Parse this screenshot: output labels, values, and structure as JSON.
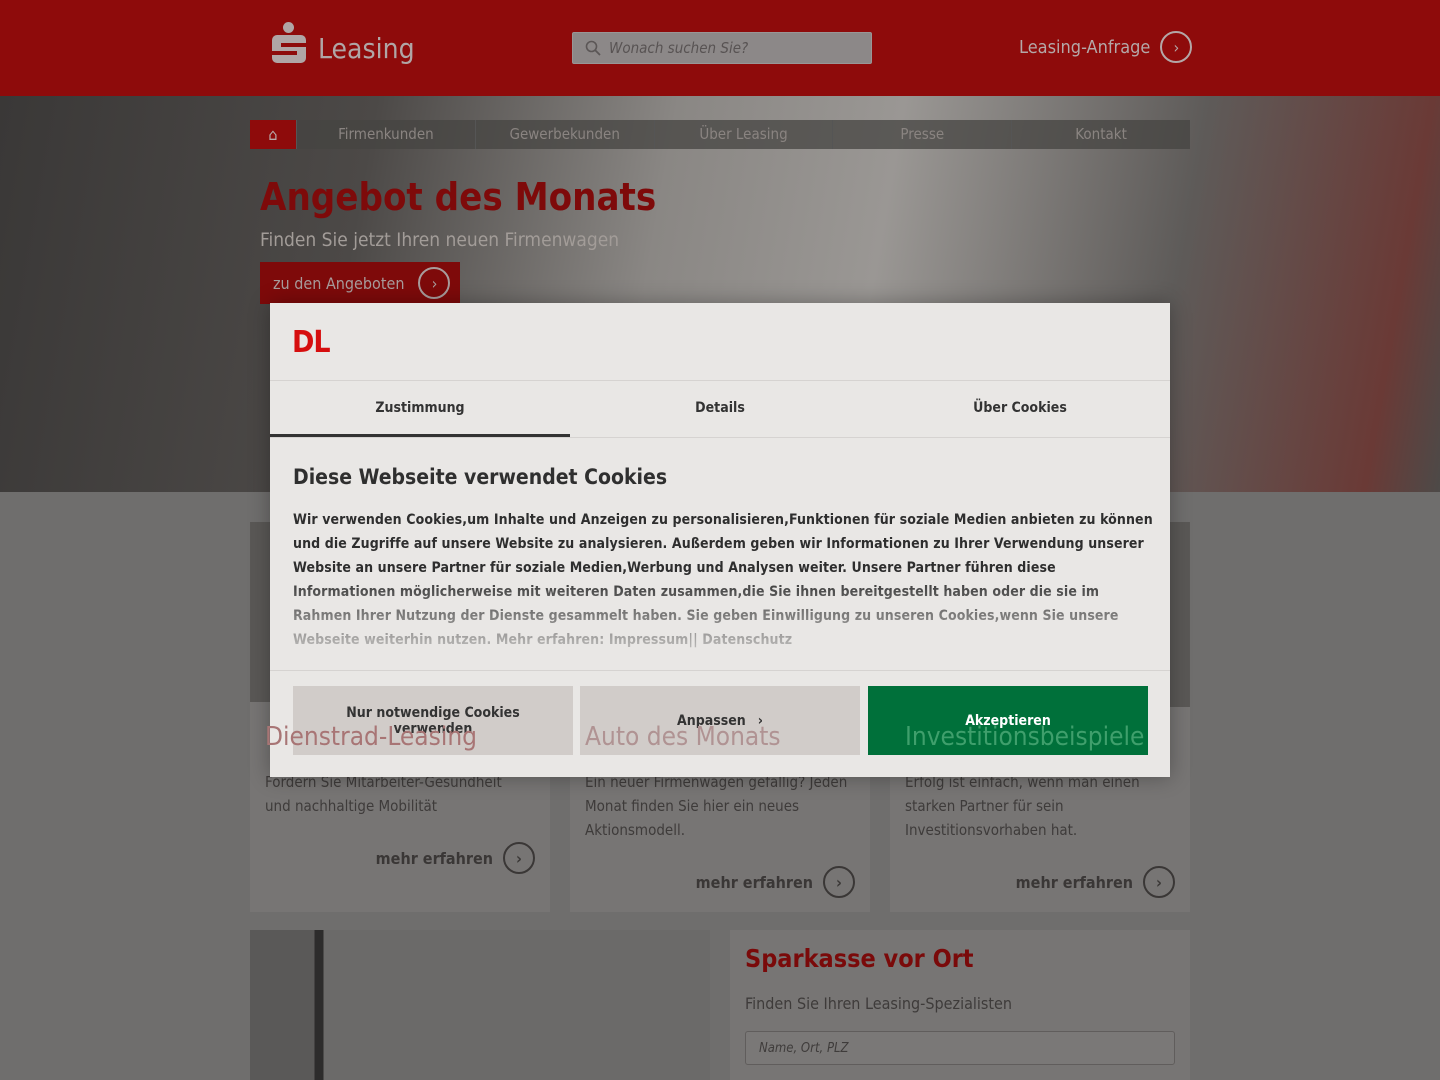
{
  "header": {
    "logo_text": "Leasing",
    "search_placeholder": "Wonach suchen Sie?",
    "cta": "Leasing-Anfrage"
  },
  "nav": {
    "items": [
      "Firmenkunden",
      "Gewerbekunden",
      "Über Leasing",
      "Presse",
      "Kontakt"
    ]
  },
  "hero": {
    "title": "Angebot des Monats",
    "subtitle": "Finden Sie jetzt Ihren neuen Firmenwagen",
    "button": "zu den Angeboten"
  },
  "cards": [
    {
      "title": "Dienstrad-Leasing",
      "text": "Fördern Sie Mitarbeiter-Gesundheit und nachhaltige Mobilität",
      "link": "mehr erfahren"
    },
    {
      "title": "Auto des Monats",
      "text": "Ein neuer Firmenwagen gefällig? Jeden Monat finden Sie hier ein neues Aktionsmodell.",
      "link": "mehr erfahren"
    },
    {
      "title": "Investitionsbeispiele",
      "text": "Erfolg ist einfach, wenn man einen starken Partner für sein Investitionsvorhaben hat.",
      "link": "mehr erfahren"
    }
  ],
  "local": {
    "title": "Sparkasse vor Ort",
    "text": "Finden Sie Ihren Leasing-Spezialisten",
    "placeholder": "Name, Ort, PLZ"
  },
  "modal": {
    "logo": "DL",
    "tabs": [
      "Zustimmung",
      "Details",
      "Über Cookies"
    ],
    "title": "Diese Webseite verwendet Cookies",
    "text": "Wir verwenden Cookies,um Inhalte und Anzeigen zu personalisieren,Funktionen für soziale Medien anbieten zu können und die Zugriffe auf unsere Website zu analysieren. Außerdem geben wir Informationen zu Ihrer Verwendung unserer Website an unsere Partner für soziale Medien,Werbung und Analysen weiter. Unsere Partner führen diese Informationen möglicherweise mit weiteren Daten zusammen,die Sie ihnen bereitgestellt haben oder die sie im Rahmen Ihrer Nutzung der Dienste gesammelt haben. Sie geben Einwilligung zu unseren Cookies,wenn Sie unsere Webseite weiterhin nutzen. Mehr erfahren: Impressum|| Datenschutz",
    "buttons": {
      "necessary": "Nur notwendige Cookies verwenden",
      "customize": "Anpassen",
      "accept": "Akzeptieren"
    },
    "accept_color": "#00703a"
  }
}
